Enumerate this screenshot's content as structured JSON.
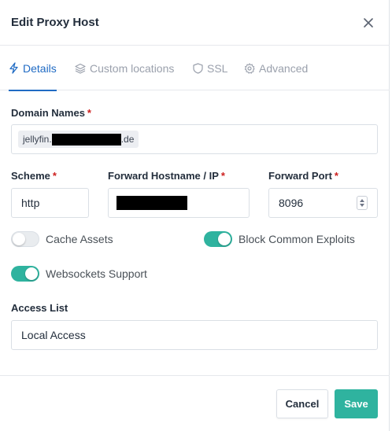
{
  "modal": {
    "title": "Edit Proxy Host"
  },
  "tabs": [
    {
      "label": "Details",
      "icon": "bolt-icon",
      "active": true
    },
    {
      "label": "Custom locations",
      "icon": "layers-icon",
      "active": false
    },
    {
      "label": "SSL",
      "icon": "shield-icon",
      "active": false
    },
    {
      "label": "Advanced",
      "icon": "gear-icon",
      "active": false
    }
  ],
  "form": {
    "domain_names": {
      "label": "Domain Names",
      "required_mark": "*",
      "chip_prefix": "jellyfin.",
      "chip_suffix": ".de"
    },
    "scheme": {
      "label": "Scheme",
      "required_mark": "*",
      "value": "http"
    },
    "forward_hostname": {
      "label": "Forward Hostname / IP",
      "required_mark": "*"
    },
    "forward_port": {
      "label": "Forward Port",
      "required_mark": "*",
      "value": "8096"
    },
    "cache_assets": {
      "label": "Cache Assets",
      "enabled": false
    },
    "block_exploits": {
      "label": "Block Common Exploits",
      "enabled": true
    },
    "websockets": {
      "label": "Websockets Support",
      "enabled": true
    },
    "access_list": {
      "label": "Access List",
      "value": "Local Access"
    }
  },
  "footer": {
    "cancel_label": "Cancel",
    "save_label": "Save"
  },
  "colors": {
    "accent": "#206bc4",
    "toggle_on": "#2fb39f",
    "required": "#cd201f"
  }
}
